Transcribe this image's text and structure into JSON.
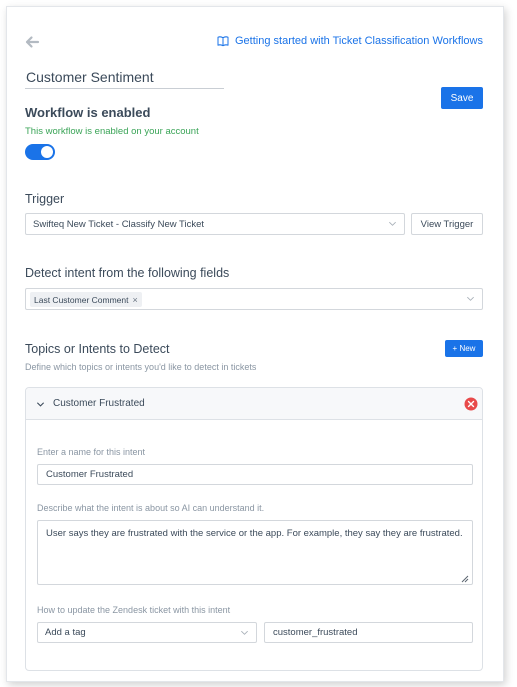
{
  "header": {
    "back_icon": "arrow-left-icon",
    "guide_icon": "book-icon",
    "guide_link": "Getting started with Ticket Classification Workflows"
  },
  "workflow": {
    "name": "Customer Sentiment",
    "save_label": "Save",
    "enabled_title": "Workflow is enabled",
    "enabled_subtitle": "This workflow is enabled on your account",
    "enabled": true
  },
  "trigger": {
    "label": "Trigger",
    "selected": "Swifteq New Ticket - Classify New Ticket",
    "view_button": "View Trigger"
  },
  "detect": {
    "label": "Detect intent from the following fields",
    "chips": [
      "Last Customer Comment"
    ]
  },
  "topics": {
    "label": "Topics or Intents to Detect",
    "subtitle": "Define which topics or intents you'd like to detect in tickets",
    "new_button": "+ New"
  },
  "intent": {
    "header_title": "Customer Frustrated",
    "name_label": "Enter a name for this intent",
    "name_value": "Customer Frustrated",
    "description_label": "Describe what the intent is about so AI can understand it.",
    "description_value": "User says they are frustrated with the service or the app. For example, they say they are frustrated.",
    "update_label": "How to update the Zendesk ticket with this intent",
    "action_selected": "Add a tag",
    "tag_value": "customer_frustrated"
  },
  "colors": {
    "accent": "#1a73e8",
    "success": "#3aa457",
    "danger": "#e84a4a"
  }
}
